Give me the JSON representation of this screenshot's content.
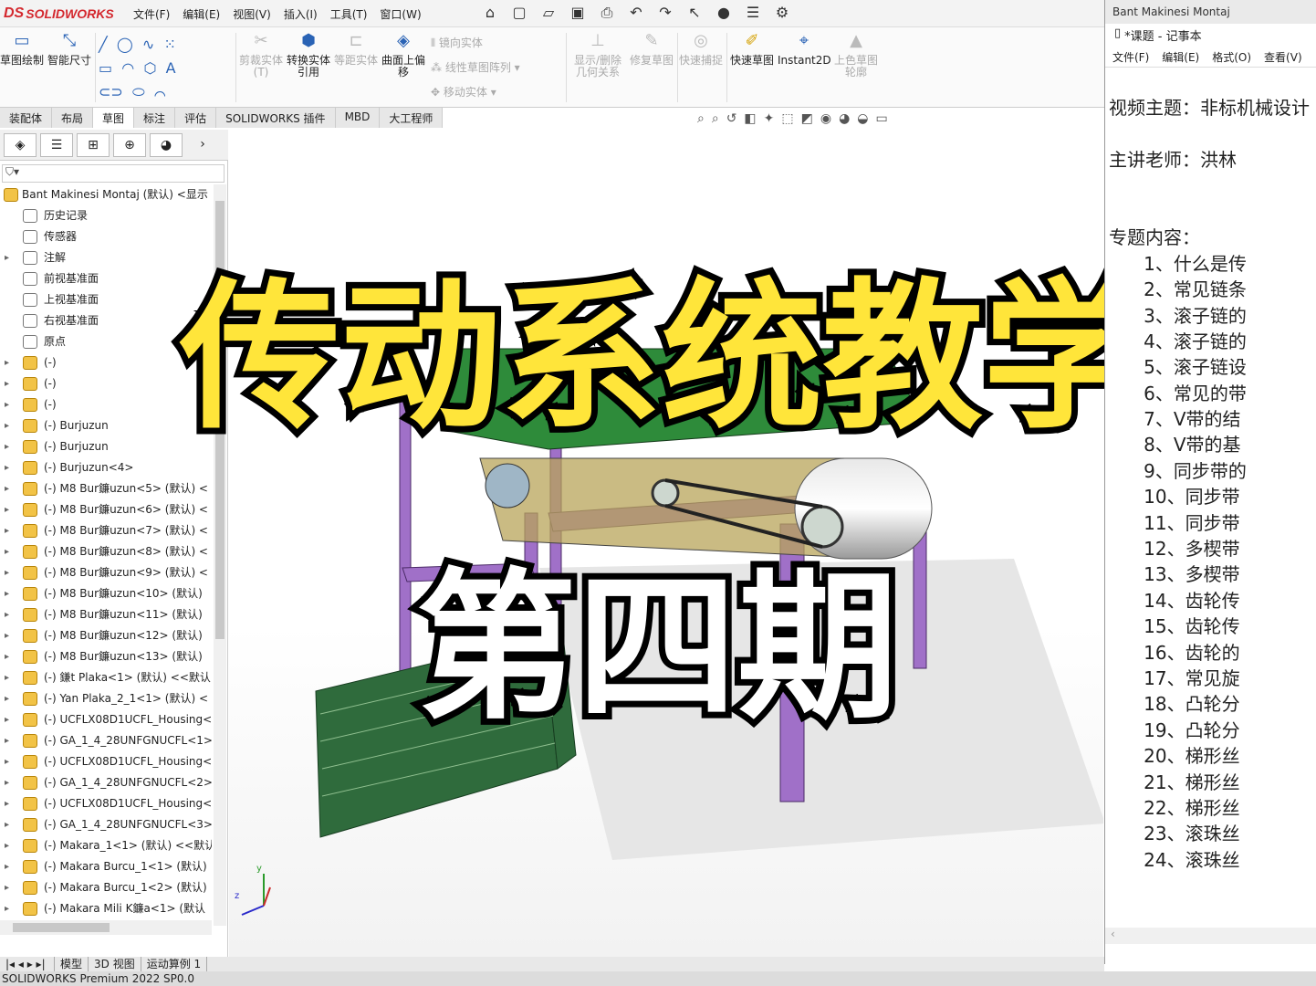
{
  "app": {
    "logo_text": "SOLIDWORKS",
    "logo_mark": "DS",
    "status": "SOLIDWORKS Premium 2022 SP0.0"
  },
  "menu": [
    "文件(F)",
    "编辑(E)",
    "视图(V)",
    "插入(I)",
    "工具(T)",
    "窗口(W)"
  ],
  "ribbon": {
    "sketch": "草图绘制",
    "smart_dim": "智能尺寸",
    "trim": "剪裁实体(T)",
    "convert": "转换实体引用",
    "offset_eq": "等距实体",
    "surface_offset": "曲面上偏移",
    "mirror": "镜向实体",
    "linear_pattern": "线性草图阵列",
    "move": "移动实体",
    "show_relations": "显示/删除几何关系",
    "repair": "修复草图",
    "quick_snap": "快速捕捉",
    "rapid_sketch": "快速草图",
    "instant2d": "Instant2D",
    "shaded_contours": "上色草图轮廓"
  },
  "tabs": [
    "装配体",
    "布局",
    "草图",
    "标注",
    "评估",
    "SOLIDWORKS 插件",
    "MBD",
    "大工程师"
  ],
  "tree": {
    "filter_icon": "filter-icon",
    "root": "Bant Makinesi Montaj (默认) <显示",
    "items": [
      {
        "label": "历史记录",
        "icon": "folder"
      },
      {
        "label": "传感器",
        "icon": "folder"
      },
      {
        "label": "注解",
        "icon": "folder",
        "arrow": "▸"
      },
      {
        "label": "前视基准面",
        "icon": "folder"
      },
      {
        "label": "上视基准面",
        "icon": "folder"
      },
      {
        "label": "右视基准面",
        "icon": "folder"
      },
      {
        "label": "原点",
        "icon": "folder"
      },
      {
        "label": "(-) ",
        "icon": "part",
        "arrow": "▸"
      },
      {
        "label": "(-) ",
        "icon": "part",
        "arrow": "▸"
      },
      {
        "label": "(-) ",
        "icon": "part",
        "arrow": "▸"
      },
      {
        "label": "(-) Burјuzun",
        "icon": "part",
        "arrow": "▸"
      },
      {
        "label": "(-) Burјuzun",
        "icon": "part",
        "arrow": "▸"
      },
      {
        "label": "(-) Burјuzun<4>",
        "icon": "part",
        "arrow": "▸"
      },
      {
        "label": "(-) M8 Bur鐮uzun<5> (默认) <",
        "icon": "part",
        "arrow": "▸"
      },
      {
        "label": "(-) M8 Bur鐮uzun<6> (默认) <",
        "icon": "part",
        "arrow": "▸"
      },
      {
        "label": "(-) M8 Bur鐮uzun<7> (默认) <",
        "icon": "part",
        "arrow": "▸"
      },
      {
        "label": "(-) M8 Bur鐮uzun<8> (默认) <",
        "icon": "part",
        "arrow": "▸"
      },
      {
        "label": "(-) M8 Bur鐮uzun<9> (默认) <",
        "icon": "part",
        "arrow": "▸"
      },
      {
        "label": "(-) M8 Bur鐮uzun<10> (默认)",
        "icon": "part",
        "arrow": "▸"
      },
      {
        "label": "(-) M8 Bur鐮uzun<11> (默认)",
        "icon": "part",
        "arrow": "▸"
      },
      {
        "label": "(-) M8 Bur鐮uzun<12> (默认)",
        "icon": "part",
        "arrow": "▸"
      },
      {
        "label": "(-) M8 Bur鐮uzun<13> (默认)",
        "icon": "part",
        "arrow": "▸"
      },
      {
        "label": "(-) 鎌t Plaka<1> (默认) <<默认",
        "icon": "part",
        "arrow": "▸"
      },
      {
        "label": "(-) Yan Plaka_2_1<1> (默认) <",
        "icon": "part",
        "arrow": "▸"
      },
      {
        "label": "(-) UCFLX08D1UCFL_Housing<",
        "icon": "part",
        "arrow": "▸"
      },
      {
        "label": "(-) GA_1_4_28UNFGNUCFL<1>",
        "icon": "part",
        "arrow": "▸"
      },
      {
        "label": "(-) UCFLX08D1UCFL_Housing<",
        "icon": "part",
        "arrow": "▸"
      },
      {
        "label": "(-) GA_1_4_28UNFGNUCFL<2>",
        "icon": "part",
        "arrow": "▸"
      },
      {
        "label": "(-) UCFLX08D1UCFL_Housing<",
        "icon": "part",
        "arrow": "▸"
      },
      {
        "label": "(-) GA_1_4_28UNFGNUCFL<3>",
        "icon": "part",
        "arrow": "▸"
      },
      {
        "label": "(-) Makara_1<1> (默认) <<默认",
        "icon": "part",
        "arrow": "▸"
      },
      {
        "label": "(-) Makara Burcu_1<1> (默认)",
        "icon": "part",
        "arrow": "▸"
      },
      {
        "label": "(-) Makara Burcu_1<2> (默认)",
        "icon": "part",
        "arrow": "▸"
      },
      {
        "label": "(-) Makara Mili K鐮a<1> (默认",
        "icon": "part",
        "arrow": "▸"
      }
    ]
  },
  "bottom_tabs": [
    "模型",
    "3D 视图",
    "运动算例 1"
  ],
  "overlay": {
    "title": "传动系统教学",
    "subtitle": "第四期"
  },
  "notepad": {
    "window_title": "Bant Makinesi Montaj",
    "title": "*课题 - 记事本",
    "menu": [
      "文件(F)",
      "编辑(E)",
      "格式(O)",
      "查看(V)"
    ],
    "lines": [
      "",
      "视频主题：非标机械设计",
      "",
      "主讲老师：洪林",
      "",
      "",
      "专题内容：",
      "      1、什么是传",
      "      2、常见链条",
      "      3、滚子链的",
      "      4、滚子链的",
      "      5、滚子链设",
      "      6、常见的带",
      "      7、V带的结",
      "      8、V带的基",
      "      9、同步带的",
      "      10、同步带",
      "      11、同步带",
      "      12、多楔带",
      "      13、多楔带",
      "      14、齿轮传",
      "      15、齿轮传",
      "      16、齿轮的",
      "      17、常见旋",
      "      18、凸轮分",
      "      19、凸轮分",
      "      20、梯形丝",
      "      21、梯形丝",
      "      22、梯形丝",
      "      23、滚珠丝",
      "      24、滚珠丝"
    ]
  },
  "colors": {
    "frame": "#a070c8",
    "belt": "#2e8b3a",
    "overlay_yellow": "#ffe53a",
    "accent_red": "#d4282e"
  }
}
